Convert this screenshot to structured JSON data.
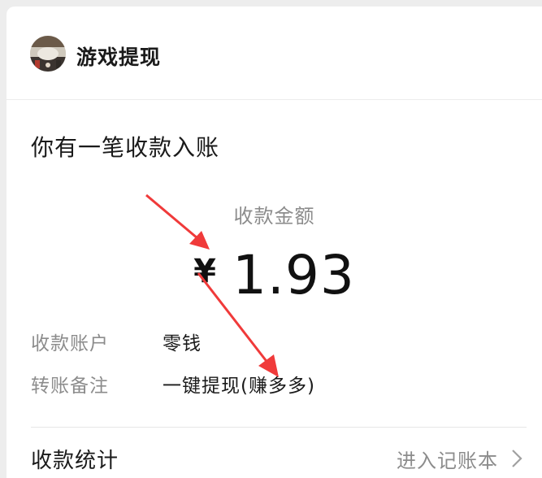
{
  "header": {
    "title": "游戏提现",
    "avatar_icon": "game-avatar-icon"
  },
  "notice": {
    "title": "你有一笔收款入账"
  },
  "amount": {
    "label": "收款金额",
    "currency": "¥",
    "value": "1.93"
  },
  "details": [
    {
      "label": "收款账户",
      "value": "零钱"
    },
    {
      "label": "转账备注",
      "value": "一键提现(赚多多)"
    }
  ],
  "stats": {
    "label": "收款统计",
    "link": "进入记账本",
    "chevron_icon": "chevron-right-icon"
  },
  "colors": {
    "background": "#ededed",
    "card": "#ffffff",
    "primary_text": "#1a1a1a",
    "secondary_text": "#8c8c8c",
    "annotation_arrow": "#f03a3a"
  }
}
